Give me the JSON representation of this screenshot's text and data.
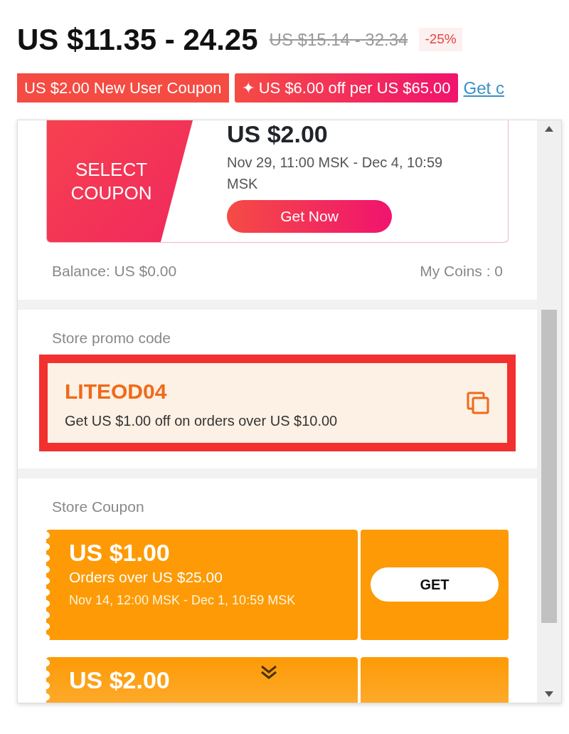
{
  "price": {
    "current": "US $11.35 - 24.25",
    "original": "US $15.14 - 32.34",
    "discount": "-25%"
  },
  "tags": [
    {
      "kind": "ticket",
      "text": "US $2.00 New User Coupon"
    },
    {
      "kind": "promo",
      "text": "✦ US $6.00 off per US $65.00"
    }
  ],
  "get_link": "Get c",
  "popup": {
    "platform_coupon": {
      "label": "SELECT COUPON",
      "amount": "US $2.00",
      "validity": "Nov 29, 11:00 MSK - Dec 4, 10:59 MSK",
      "action": "Get Now"
    },
    "balance": "Balance: US $0.00",
    "coins": "My Coins : 0",
    "promo_section": {
      "title": "Store promo code",
      "code": "LITEOD04",
      "description": "Get US $1.00 off on orders over US $10.00"
    },
    "store_section": {
      "title": "Store Coupon",
      "coupons": [
        {
          "amount": "US $1.00",
          "condition": "Orders over US $25.00",
          "validity": "Nov 14, 12:00 MSK - Dec 1, 10:59 MSK",
          "action": "GET"
        },
        {
          "amount": "US $2.00"
        }
      ]
    }
  }
}
